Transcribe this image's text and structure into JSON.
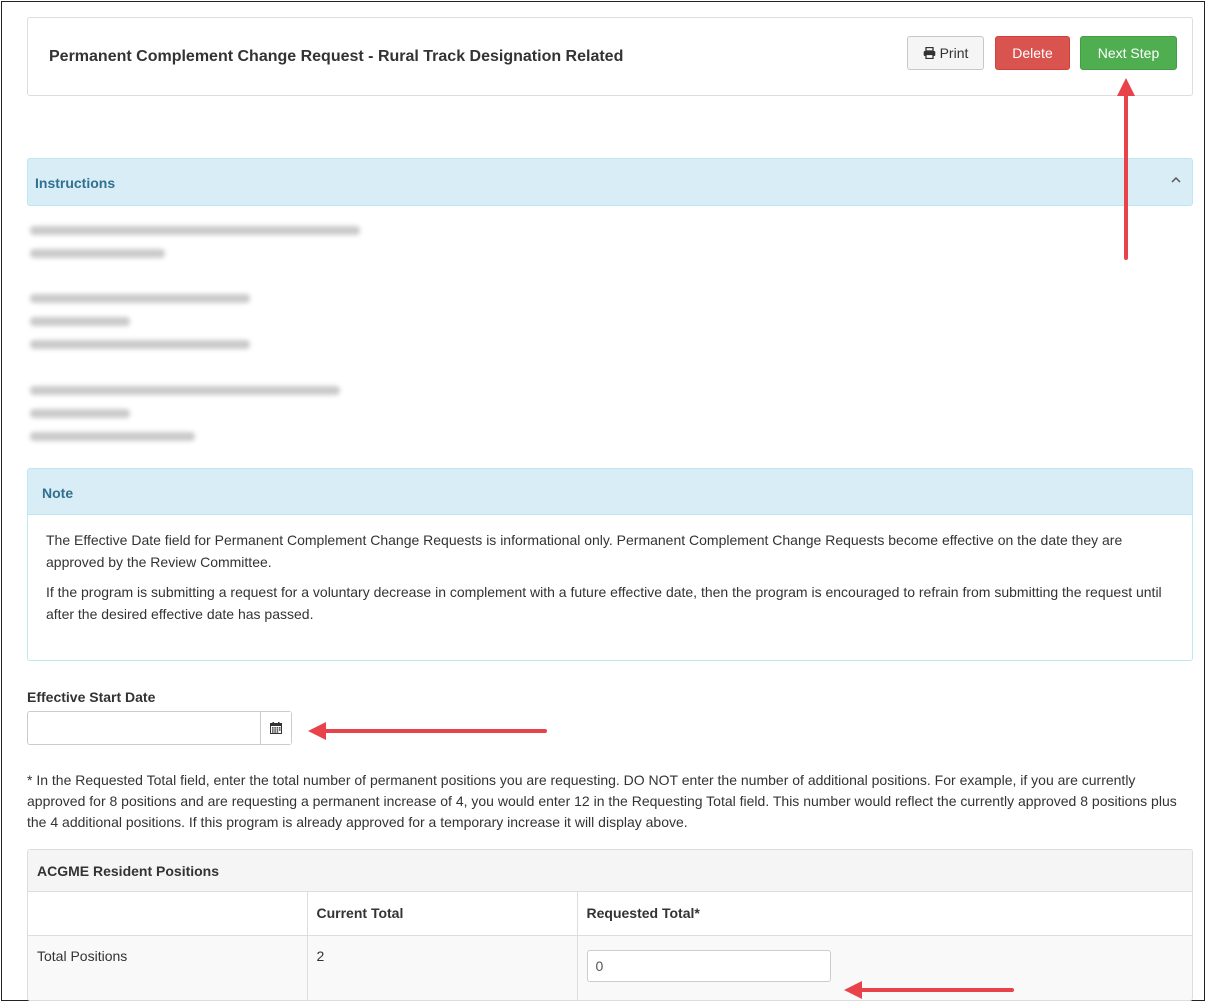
{
  "header": {
    "title": "Permanent Complement Change Request - Rural Track Designation Related",
    "print_label": "Print",
    "delete_label": "Delete",
    "next_label": "Next Step"
  },
  "instructions": {
    "title": "Instructions"
  },
  "note": {
    "title": "Note",
    "paragraphs": [
      "The Effective Date field for Permanent Complement Change Requests is informational only. Permanent Complement Change Requests become effective on the date they are approved by the Review Committee.",
      "If the program is submitting a request for a voluntary decrease in complement with a future effective date, then the program is encouraged to refrain from submitting the request until after the desired effective date has passed."
    ]
  },
  "effective_date": {
    "label": "Effective Start Date",
    "value": ""
  },
  "info_text": "* In the Requested Total field, enter the total number of permanent positions you are requesting. DO NOT enter the number of additional positions. For example, if you are currently approved for 8 positions and are requesting a permanent increase of 4, you would enter 12 in the Requesting Total field. This number would reflect the currently approved 8 positions plus the 4 additional positions. If this program is already approved for a temporary increase it will display above.",
  "positions_table": {
    "title": "ACGME Resident Positions",
    "columns": [
      "",
      "Current Total",
      "Requested Total*"
    ],
    "rows": [
      {
        "label": "Total Positions",
        "current": "2",
        "requested": "0"
      }
    ]
  },
  "colors": {
    "danger": "#d9534f",
    "success": "#4fae4f",
    "info_bg": "#d9edf7",
    "info_text": "#31708f",
    "annotation": "#e8434a"
  },
  "icons": [
    "printer-icon",
    "chevron-up-icon",
    "calendar-icon"
  ]
}
